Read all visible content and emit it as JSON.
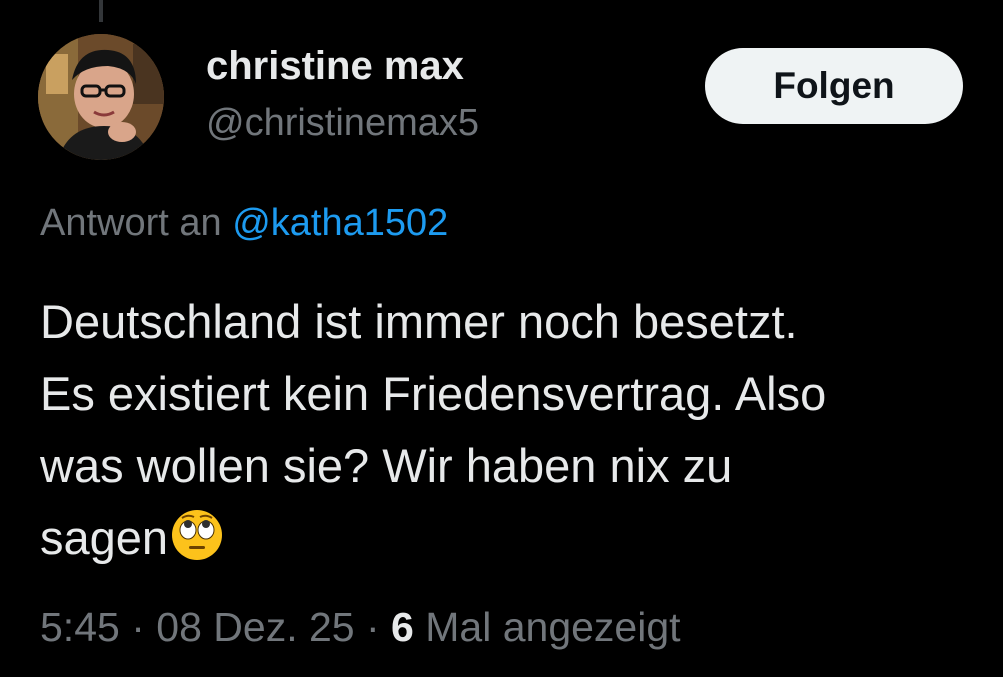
{
  "author": {
    "display_name": "christine max",
    "handle": "@christinemax5"
  },
  "follow_button": {
    "label": "Folgen"
  },
  "reply": {
    "prefix": "Antwort an",
    "mention": "@katha1502"
  },
  "tweet": {
    "lines": [
      "Deutschland ist immer noch besetzt.",
      "Es existiert kein Friedensvertrag. Also",
      "was wollen sie? Wir haben nix zu",
      "sagen"
    ],
    "emoji": "face-with-rolling-eyes"
  },
  "meta": {
    "time": "5:45",
    "separator": "·",
    "date": "08 Dez. 25",
    "views_count": "6",
    "views_label": "Mal angezeigt"
  },
  "colors": {
    "background": "#000000",
    "text": "#e7e9ea",
    "secondary": "#71767b",
    "link": "#1d9bf0",
    "button_bg": "#eff3f4"
  }
}
